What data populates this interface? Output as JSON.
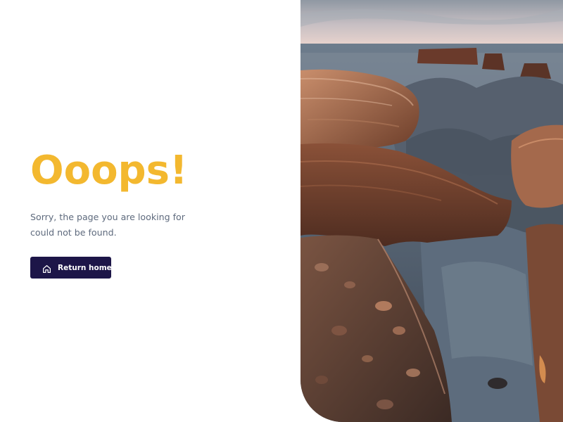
{
  "error_page": {
    "title": "Ooops!",
    "message": "Sorry, the page you are looking for could not be found.",
    "button_label": "Return home",
    "button_icon": "home-icon"
  },
  "colors": {
    "accent": "#f3b82f",
    "button_bg": "#1d1648",
    "text_muted": "#5e6a7d"
  }
}
